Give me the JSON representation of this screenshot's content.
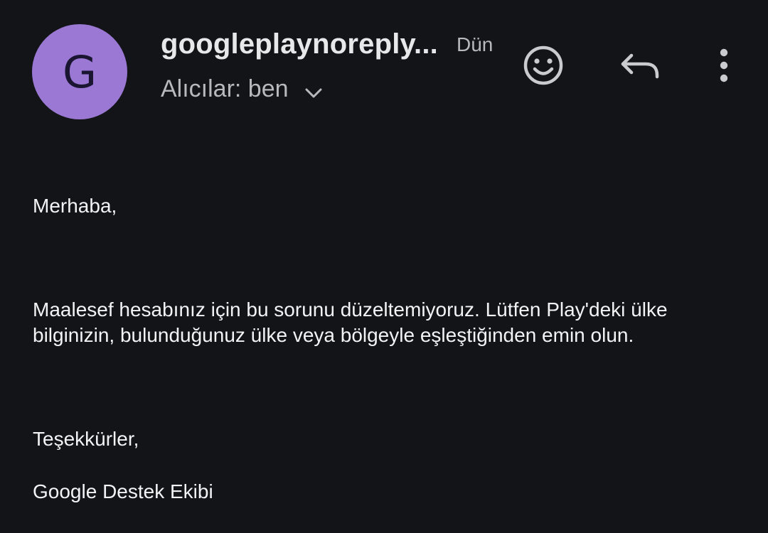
{
  "header": {
    "avatar_letter": "G",
    "avatar_color": "#9a78d3",
    "sender": "googleplaynoreply...",
    "date": "Dün",
    "recipients": "Alıcılar: ben",
    "icons": {
      "emoji": "smiley-face-icon",
      "reply": "reply-arrow-icon",
      "more": "more-vertical-icon",
      "expand": "chevron-down-icon"
    }
  },
  "message": {
    "greeting": "Merhaba,",
    "body_line1": "Maalesef hesabınız için bu sorunu düzeltemiyoruz. Lütfen Play'deki ülke",
    "body_line2": "bilginizin, bulunduğunuz ülke veya bölgeyle eşleştiğinden emin olun.",
    "thanks": "Teşekkürler,",
    "signature": "Google Destek Ekibi"
  },
  "colors": {
    "background": "#131417",
    "text_primary": "#f2f3f5",
    "text_secondary": "#b7b9bd"
  }
}
